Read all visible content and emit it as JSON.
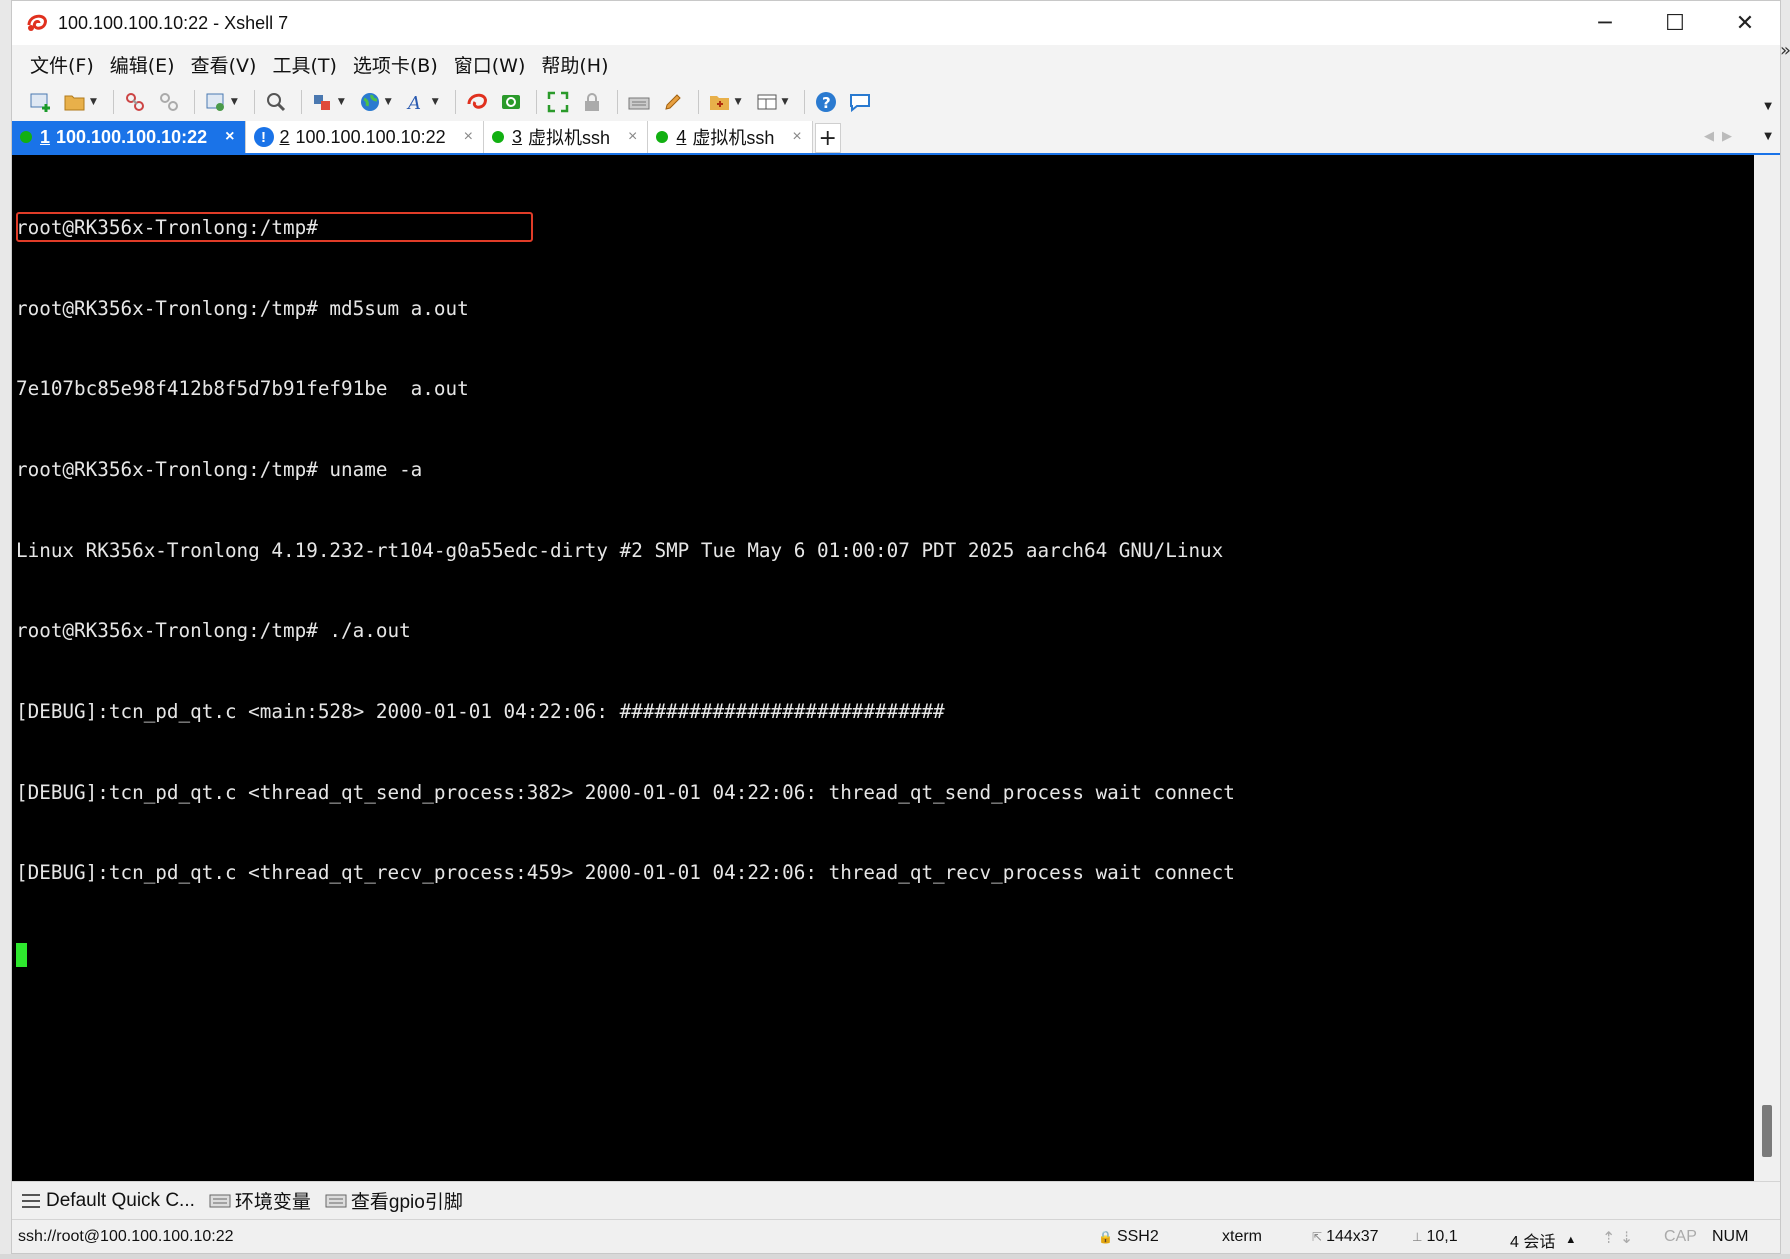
{
  "window": {
    "title": "100.100.100.10:22 - Xshell 7",
    "controls": {
      "minimize": "─",
      "maximize": "☐",
      "close": "✕"
    }
  },
  "menu": [
    "文件(F)",
    "编辑(E)",
    "查看(V)",
    "工具(T)",
    "选项卡(B)",
    "窗口(W)",
    "帮助(H)"
  ],
  "tabs": [
    {
      "num": "1",
      "label": "100.100.100.10:22",
      "status": "connected",
      "active": true,
      "close": "×"
    },
    {
      "num": "2",
      "label": "100.100.100.10:22",
      "status": "warning",
      "active": false,
      "close": "×"
    },
    {
      "num": "3",
      "label": "虚拟机ssh",
      "status": "connected",
      "active": false,
      "close": "×"
    },
    {
      "num": "4",
      "label": "虚拟机ssh",
      "status": "connected",
      "active": false,
      "close": "×"
    }
  ],
  "tab_add": "+",
  "tab_warn_glyph": "!",
  "terminal": {
    "lines": [
      "root@RK356x-Tronlong:/tmp#",
      "root@RK356x-Tronlong:/tmp# md5sum a.out",
      "7e107bc85e98f412b8f5d7b91fef91be  a.out",
      "root@RK356x-Tronlong:/tmp# uname -a",
      "Linux RK356x-Tronlong 4.19.232-rt104-g0a55edc-dirty #2 SMP Tue May 6 01:00:07 PDT 2025 aarch64 GNU/Linux",
      "root@RK356x-Tronlong:/tmp# ./a.out",
      "[DEBUG]:tcn_pd_qt.c <main:528> 2000-01-01 04:22:06: ############################",
      "[DEBUG]:tcn_pd_qt.c <thread_qt_send_process:382> 2000-01-01 04:22:06: thread_qt_send_process wait connect",
      "[DEBUG]:tcn_pd_qt.c <thread_qt_recv_process:459> 2000-01-01 04:22:06: thread_qt_recv_process wait connect"
    ],
    "colors": {
      "background": "#000000",
      "foreground": "#e6e6e6",
      "cursor": "#2ee82e",
      "highlight_box": "#e03c28"
    }
  },
  "quickbar": [
    {
      "icon": "menu-lines-icon",
      "label": "Default Quick C..."
    },
    {
      "icon": "keyboard-icon",
      "label": "环境变量"
    },
    {
      "icon": "keyboard-icon",
      "label": "查看gpio引脚"
    }
  ],
  "statusbar": {
    "connection": "ssh://root@100.100.100.10:22",
    "protocol": "SSH2",
    "terminal_type": "xterm",
    "size": "144x37",
    "position": "10,1",
    "sessions": "4 会话",
    "caps": "CAP",
    "num": "NUM"
  },
  "accent_color": "#1a73e8"
}
